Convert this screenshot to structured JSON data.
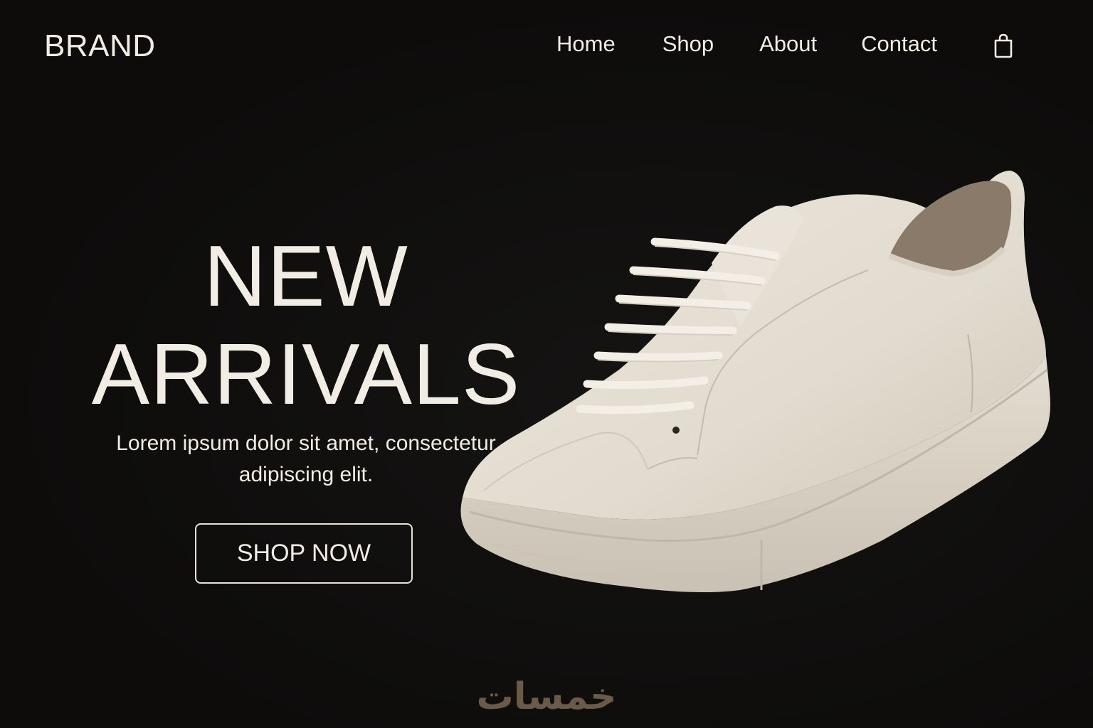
{
  "header": {
    "brand": "BRAND",
    "nav": [
      "Home",
      "Shop",
      "About",
      "Contact"
    ],
    "cart_icon": "shopping-bag-icon"
  },
  "hero": {
    "title_line1": "NEW",
    "title_line2": "ARRIVALS",
    "subtitle": "Lorem ipsum dolor sit amet, consectetur adipiscing elit.",
    "cta": "SHOP NOW"
  },
  "watermark": "خمسات",
  "colors": {
    "background": "#0e0d0c",
    "text": "#f1ece4",
    "shoe": "#e6dfd3",
    "watermark": "#6a5a4a"
  }
}
